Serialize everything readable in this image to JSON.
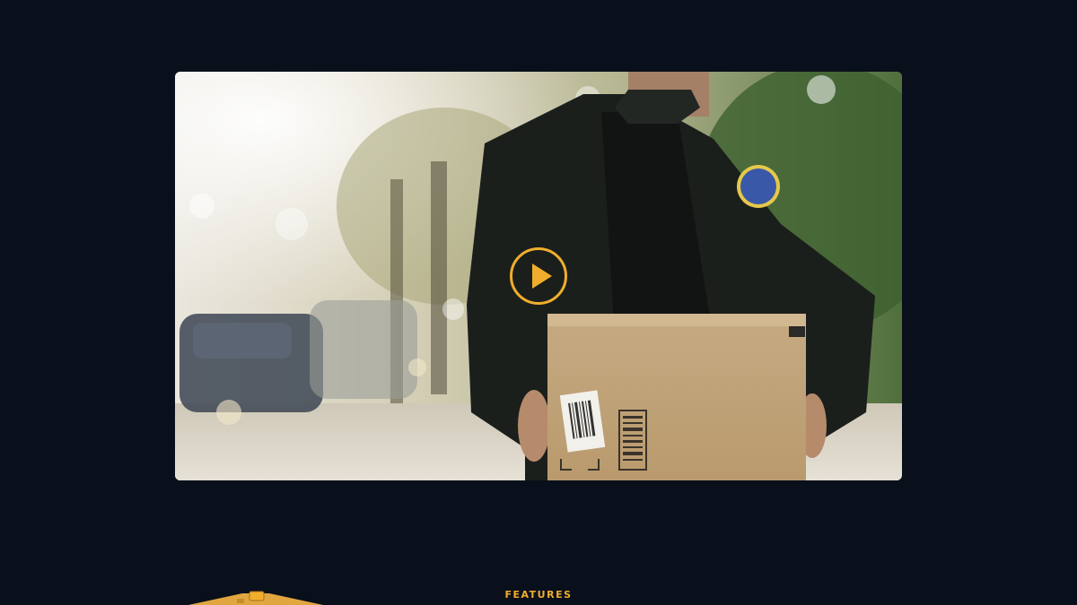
{
  "video": {
    "thumbnail": "person-holding-cardboard-box",
    "play_icon": "play-icon",
    "accent_color": "#f0ae2c"
  },
  "features_section": {
    "eyebrow": "FEATURES"
  },
  "colors": {
    "background": "#0a101b",
    "accent": "#f0ae2c"
  }
}
